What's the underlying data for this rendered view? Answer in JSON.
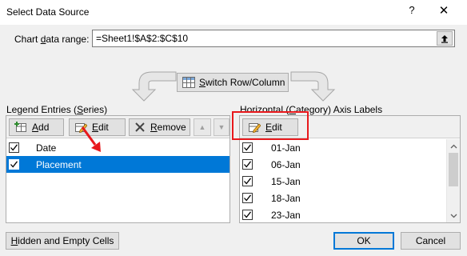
{
  "title": "Select Data Source",
  "help_glyph": "?",
  "close_glyph": "✕",
  "range": {
    "label": "Chart data range:",
    "value": "=Sheet1!$A$2:$C$10"
  },
  "switch_label": "Switch Row/Column",
  "legend": {
    "title": "Legend Entries (Series)",
    "add_label": "Add",
    "edit_label": "Edit",
    "remove_label": "Remove",
    "up_glyph": "▲",
    "down_glyph": "▼",
    "series": [
      {
        "label": "Date",
        "checked": true,
        "selected": false
      },
      {
        "label": "Placement",
        "checked": true,
        "selected": true
      }
    ]
  },
  "axis": {
    "title": "Horizontal (Category) Axis Labels",
    "edit_label": "Edit",
    "categories": [
      "01-Jan",
      "06-Jan",
      "15-Jan",
      "18-Jan",
      "23-Jan"
    ]
  },
  "hidden_cells_label": "Hidden and Empty Cells",
  "ok_label": "OK",
  "cancel_label": "Cancel",
  "colors": {
    "accent": "#0078d7",
    "highlight": "#e8181c"
  },
  "icons": [
    "switch-row-column-icon",
    "add-series-icon",
    "edit-pencil-icon",
    "remove-x-icon",
    "collapse-range-icon"
  ]
}
